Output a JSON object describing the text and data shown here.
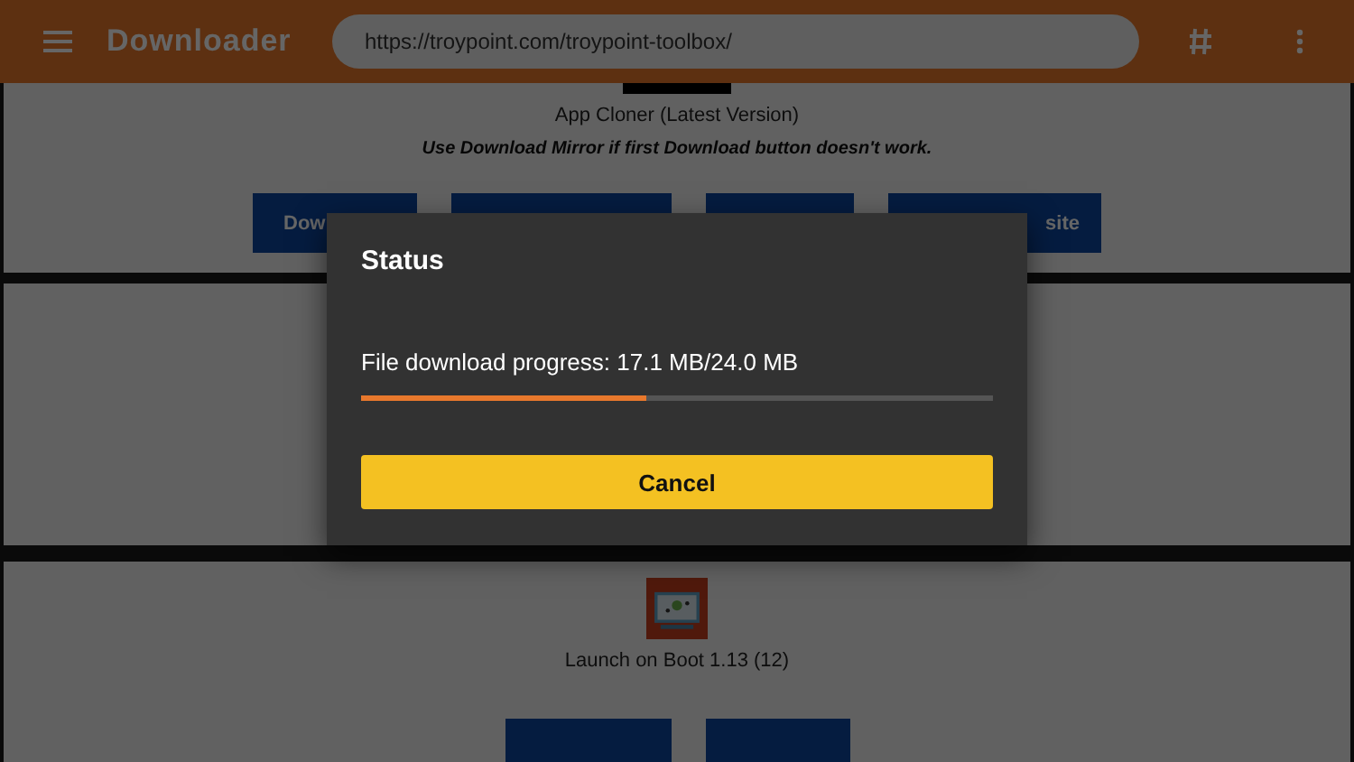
{
  "app_bar": {
    "title": "Downloader",
    "url": "https://troypoint.com/troypoint-toolbox/"
  },
  "cards": [
    {
      "kind": "app",
      "caption": "App Cloner (Latest Version)",
      "note": "Use Download Mirror if first Download button doesn't work.",
      "buttons": [
        {
          "kind": "labelled",
          "label": "Dow"
        },
        {
          "kind": "blank"
        },
        {
          "kind": "blank"
        },
        {
          "kind": "labelled",
          "label": "site"
        }
      ]
    },
    {
      "kind": "empty"
    },
    {
      "kind": "app_picture",
      "caption": "Launch on Boot 1.13 (12)",
      "buttons": [
        {
          "kind": "blank"
        },
        {
          "kind": "blank"
        }
      ]
    }
  ],
  "dialog": {
    "title": "Status",
    "message": "File download progress: 17.1 MB/24.0 MB",
    "level": 0.45,
    "button": "Cancel"
  }
}
